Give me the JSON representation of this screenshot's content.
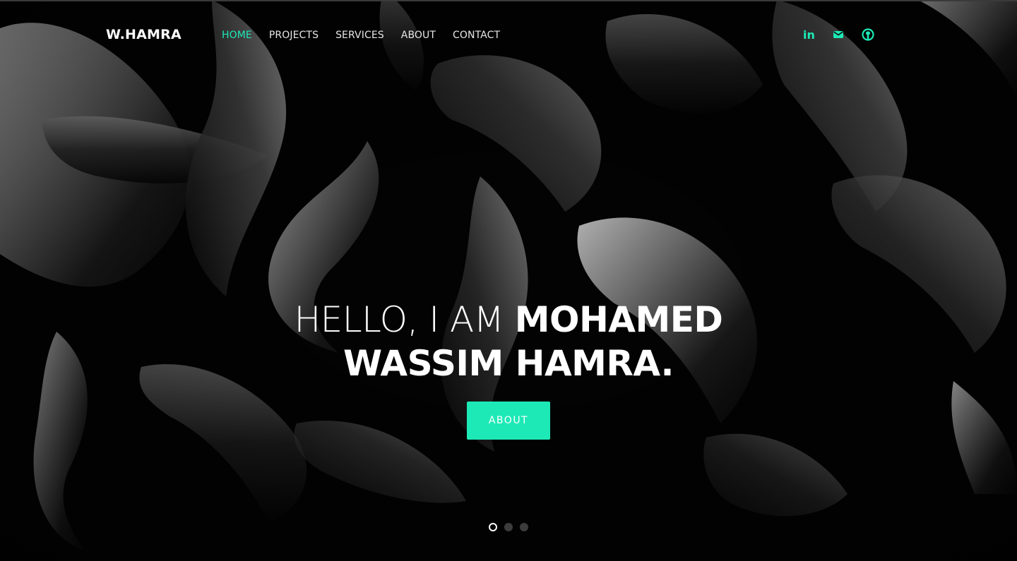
{
  "header": {
    "brand": "W.HAMRA",
    "nav": [
      {
        "label": "HOME",
        "active": true
      },
      {
        "label": "PROJECTS",
        "active": false
      },
      {
        "label": "SERVICES",
        "active": false
      },
      {
        "label": "ABOUT",
        "active": false
      },
      {
        "label": "CONTACT",
        "active": false
      }
    ],
    "social_icons": [
      "linkedin-icon",
      "mail-icon",
      "github-icon"
    ],
    "linkedin_text": "in"
  },
  "hero": {
    "line1_light": "HELLO, I AM ",
    "line1_bold": "MOHAMED",
    "line2_bold": "WASSIM HAMRA.",
    "cta_label": "ABOUT"
  },
  "slider": {
    "slide_count": 3,
    "active_index": 0
  },
  "colors": {
    "accent": "#1de9b6",
    "background": "#000000",
    "text": "#ffffff"
  }
}
